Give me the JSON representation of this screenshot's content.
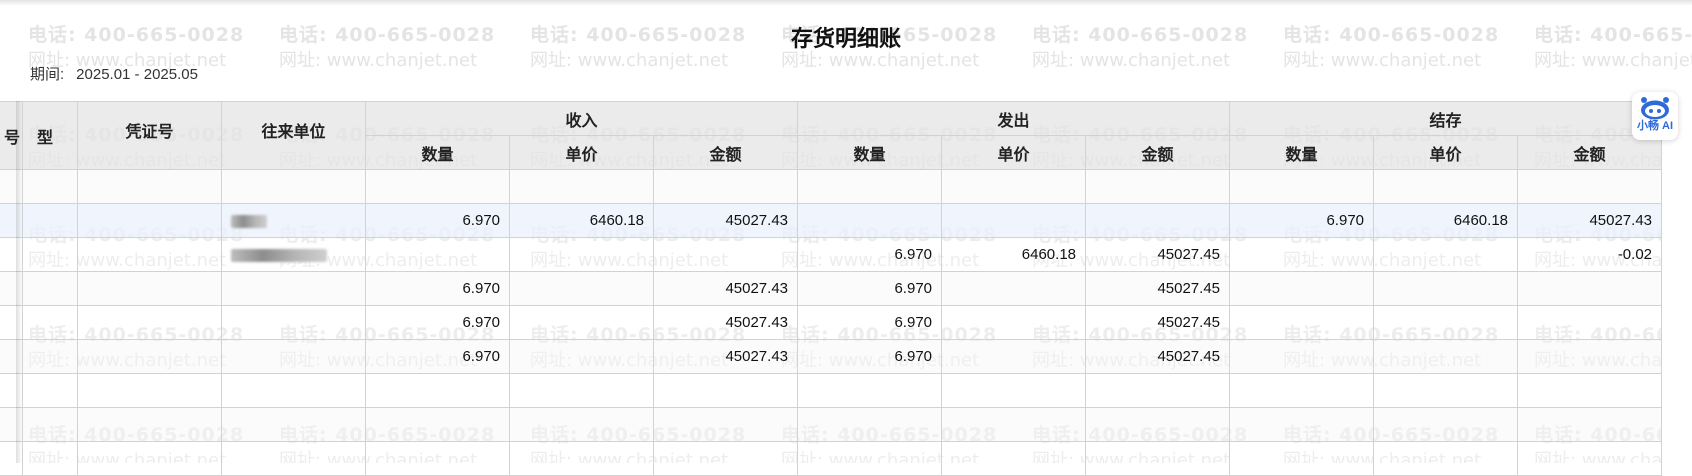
{
  "report": {
    "title": "存货明细账",
    "period_label": "期间:",
    "period_value": "2025.01 - 2025.05"
  },
  "watermark": {
    "phone": "电话: 400-665-0028",
    "site": "网址: www.chanjet.net"
  },
  "ai_assistant": {
    "label": "小畅 AI"
  },
  "table": {
    "headers": {
      "type_tail": "号",
      "type": "型",
      "voucher_no": "凭证号",
      "counterparty": "往来单位",
      "income": "收入",
      "outgoing": "发出",
      "balance": "结存",
      "qty": "数量",
      "unit_price": "单价",
      "amount": "金额"
    },
    "rows": [
      {
        "counterparty_blurred": false,
        "in_qty": "",
        "in_price": "",
        "in_amount": "",
        "out_qty": "",
        "out_price": "",
        "out_amount": "",
        "bal_qty": "",
        "bal_price": "",
        "bal_amount": ""
      },
      {
        "counterparty_blurred": true,
        "in_qty": "6.970",
        "in_price": "6460.18",
        "in_amount": "45027.43",
        "out_qty": "",
        "out_price": "",
        "out_amount": "",
        "bal_qty": "6.970",
        "bal_price": "6460.18",
        "bal_amount": "45027.43"
      },
      {
        "counterparty_blurred": true,
        "in_qty": "",
        "in_price": "",
        "in_amount": "",
        "out_qty": "6.970",
        "out_price": "6460.18",
        "out_amount": "45027.45",
        "bal_qty": "",
        "bal_price": "",
        "bal_amount": "-0.02"
      },
      {
        "counterparty_blurred": false,
        "in_qty": "6.970",
        "in_price": "",
        "in_amount": "45027.43",
        "out_qty": "6.970",
        "out_price": "",
        "out_amount": "45027.45",
        "bal_qty": "",
        "bal_price": "",
        "bal_amount": ""
      },
      {
        "counterparty_blurred": false,
        "in_qty": "6.970",
        "in_price": "",
        "in_amount": "45027.43",
        "out_qty": "6.970",
        "out_price": "",
        "out_amount": "45027.45",
        "bal_qty": "",
        "bal_price": "",
        "bal_amount": ""
      },
      {
        "counterparty_blurred": false,
        "in_qty": "6.970",
        "in_price": "",
        "in_amount": "45027.43",
        "out_qty": "6.970",
        "out_price": "",
        "out_amount": "45027.45",
        "bal_qty": "",
        "bal_price": "",
        "bal_amount": ""
      },
      {
        "counterparty_blurred": false,
        "in_qty": "",
        "in_price": "",
        "in_amount": "",
        "out_qty": "",
        "out_price": "",
        "out_amount": "",
        "bal_qty": "",
        "bal_price": "",
        "bal_amount": ""
      },
      {
        "counterparty_blurred": false,
        "in_qty": "",
        "in_price": "",
        "in_amount": "",
        "out_qty": "",
        "out_price": "",
        "out_amount": "",
        "bal_qty": "",
        "bal_price": "",
        "bal_amount": ""
      },
      {
        "counterparty_blurred": false,
        "in_qty": "",
        "in_price": "",
        "in_amount": "",
        "out_qty": "",
        "out_price": "",
        "out_amount": "",
        "bal_qty": "",
        "bal_price": "",
        "bal_amount": ""
      }
    ]
  },
  "colors": {
    "negative": "#d4232a",
    "selected_row": "#ecf3fd",
    "header_bg": "#e6e6e6",
    "ai_accent": "#2f6bd8"
  },
  "icons": {
    "ai_assistant": "robot-icon"
  }
}
